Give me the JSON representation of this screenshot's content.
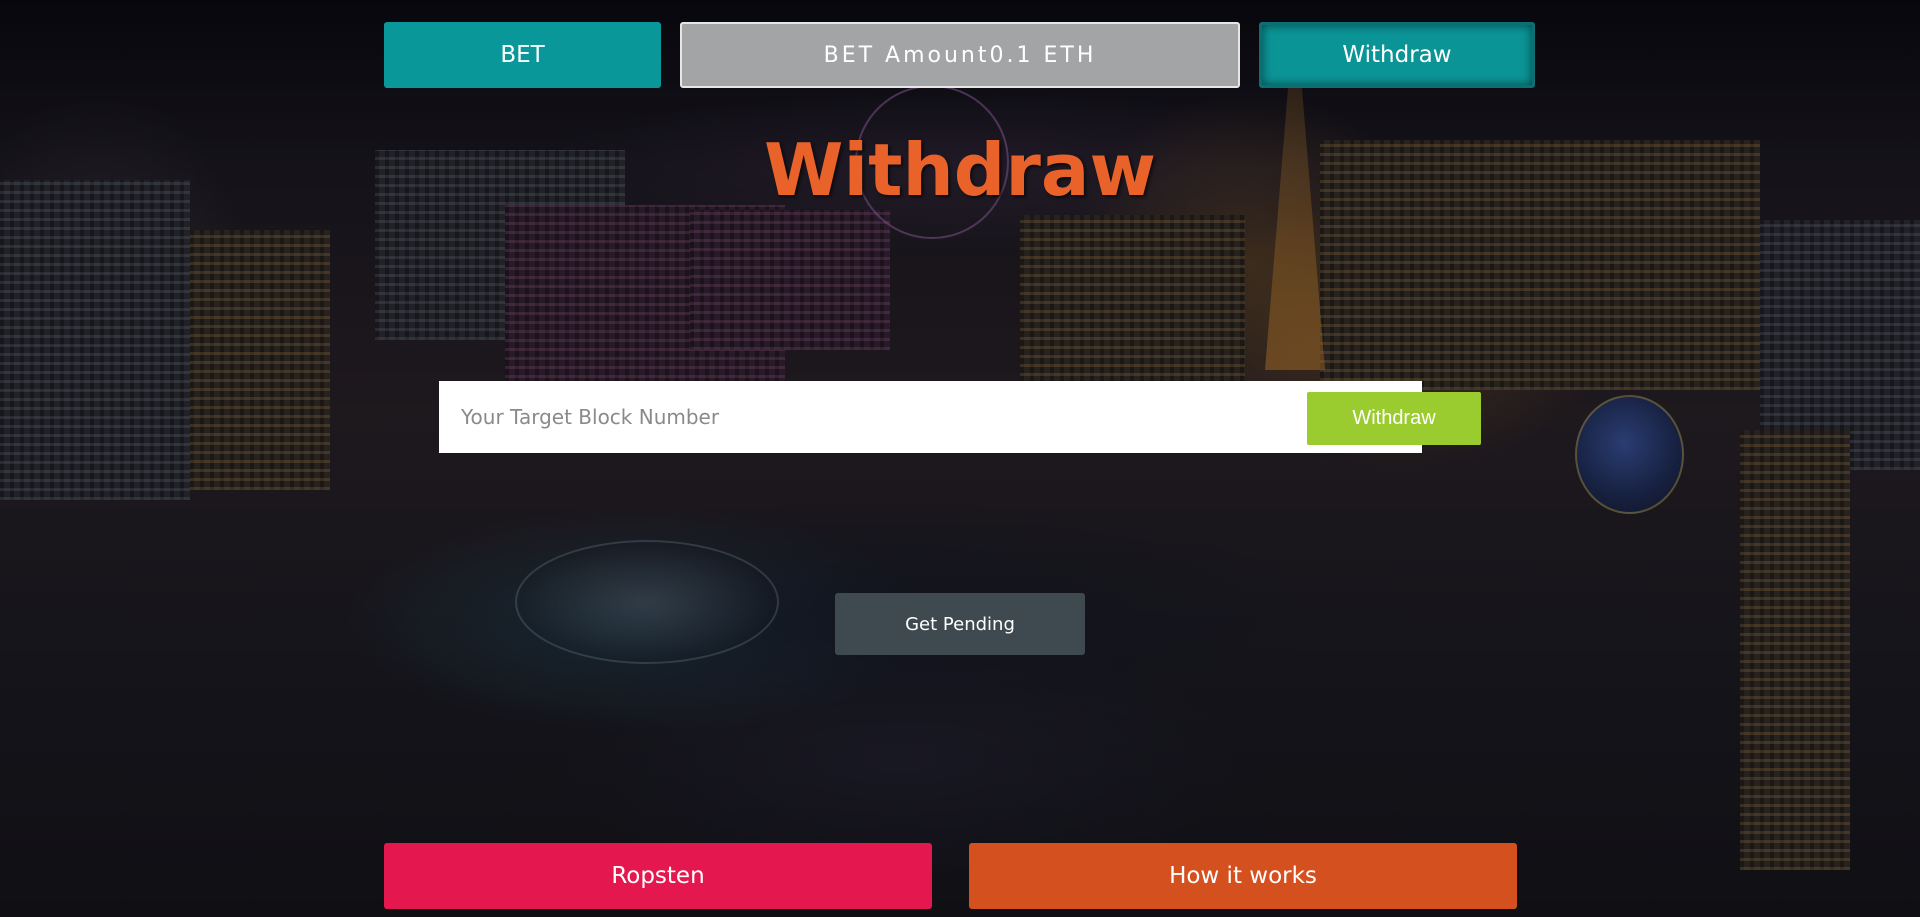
{
  "nav": {
    "bet_label": "BET",
    "bet_amount_label": "BET Amount0.1 ETH",
    "withdraw_label": "Withdraw"
  },
  "main": {
    "title": "Withdraw",
    "block_input": {
      "value": "",
      "placeholder": "Your Target Block Number"
    },
    "withdraw_button_label": "Withdraw",
    "get_pending_label": "Get Pending"
  },
  "footer": {
    "ropsten_label": "Ropsten",
    "how_it_works_label": "How it works"
  },
  "colors": {
    "teal": "#0a9799",
    "gray": "#a3a4a6",
    "orange_title": "#e8622a",
    "green": "#9bcc2f",
    "slate": "#3f4a50",
    "crimson": "#e5174f",
    "orange": "#d4501f"
  }
}
